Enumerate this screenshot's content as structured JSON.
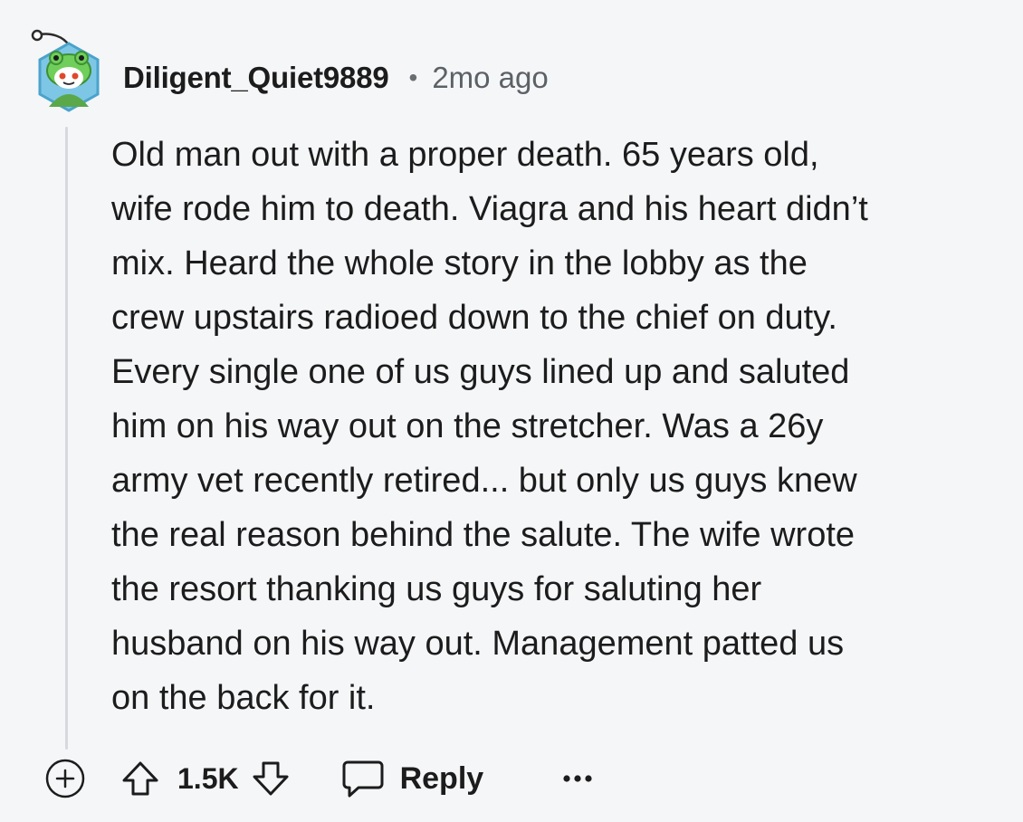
{
  "comment": {
    "username": "Diligent_Quiet9889",
    "separator": "•",
    "timestamp": "2mo ago",
    "body_lines": [
      "Old man out with a proper death. 65 years old,",
      "wife rode him to death. Viagra and his heart didn’t",
      "mix. Heard the whole story in the lobby as the",
      "crew upstairs radioed down to the chief on duty.",
      "Every single one of us guys lined up and saluted",
      "him on his way out on the stretcher. Was a 26y",
      "army vet recently retired... but only us guys knew",
      "the real reason behind the salute. The wife wrote",
      "the resort thanking us guys for saluting her",
      "husband on his way out. Management patted us",
      "on the back for it."
    ]
  },
  "actions": {
    "expand_icon": "plus-circle-icon",
    "upvote_icon": "arrow-up-icon",
    "score": "1.5K",
    "downvote_icon": "arrow-down-icon",
    "reply_icon": "speech-bubble-icon",
    "reply_label": "Reply",
    "more_icon": "ellipsis-icon"
  },
  "colors": {
    "background": "#f5f6f8",
    "text": "#1c1c1c",
    "muted": "#5c6166",
    "thread_line": "#d6d9de",
    "avatar_bg": "#7ec6e6",
    "avatar_hat": "#6fcf5a"
  }
}
